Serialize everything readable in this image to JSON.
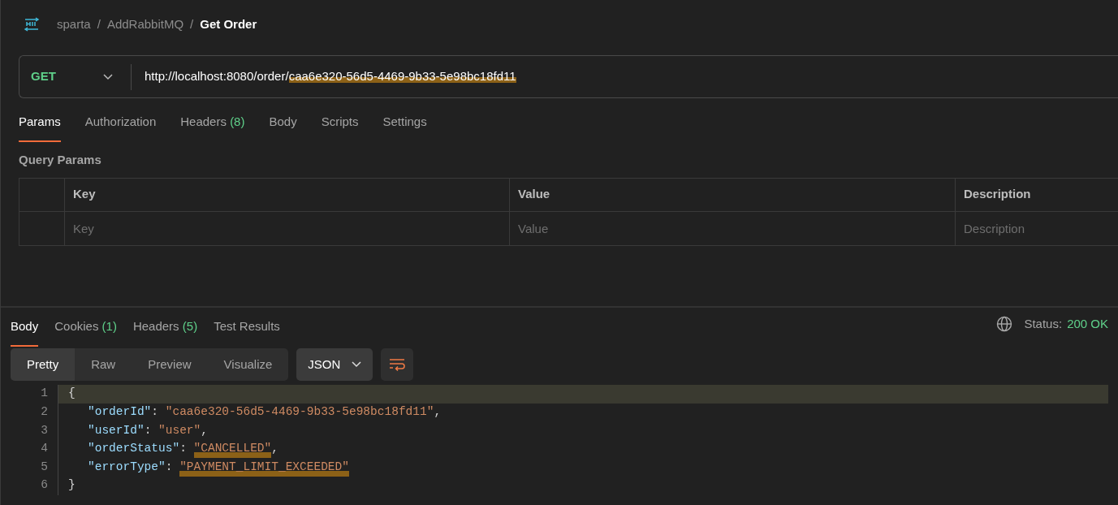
{
  "breadcrumb": [
    {
      "text": "sparta",
      "current": false
    },
    {
      "separator": "/",
      "text": "AddRabbitMQ",
      "current": false
    },
    {
      "separator": "/",
      "text": "Get Order",
      "current": true
    }
  ],
  "request": {
    "method": "GET",
    "url_parts": [
      {
        "text": "http://localhost:8080/order/",
        "highlighted": false
      },
      {
        "text": "caa6e320-56d5-4469-9b33-5e98bc18fd11",
        "highlighted": true
      }
    ]
  },
  "request_tabs": [
    {
      "label": "Params",
      "selected": true
    },
    {
      "label": "Authorization",
      "selected": false
    },
    {
      "label": "Headers",
      "count": "(8)",
      "selected": false
    },
    {
      "label": "Body",
      "selected": false
    },
    {
      "label": "Scripts",
      "selected": false
    },
    {
      "label": "Settings",
      "selected": false
    }
  ],
  "query_params": {
    "title": "Query Params",
    "columns": [
      "Key",
      "Value",
      "Description"
    ],
    "placeholders": [
      "Key",
      "Value",
      "Description"
    ]
  },
  "response_tabs": [
    {
      "label": "Body",
      "selected": true
    },
    {
      "label": "Cookies",
      "count": "(1)",
      "selected": false
    },
    {
      "label": "Headers",
      "count": "(5)",
      "selected": false
    },
    {
      "label": "Test Results",
      "selected": false
    }
  ],
  "status": {
    "label": "Status:",
    "value": "200 OK"
  },
  "view_modes": [
    {
      "label": "Pretty",
      "selected": true
    },
    {
      "label": "Raw",
      "selected": false
    },
    {
      "label": "Preview",
      "selected": false
    },
    {
      "label": "Visualize",
      "selected": false
    }
  ],
  "format": "JSON",
  "code_lines": [
    {
      "number": "1",
      "active": true,
      "indented": false,
      "tokens": [
        {
          "kind": "punct",
          "text": "{",
          "highlighted": false
        }
      ]
    },
    {
      "number": "2",
      "active": false,
      "indented": true,
      "tokens": [
        {
          "kind": "key",
          "text": "\"orderId\"",
          "highlighted": false
        },
        {
          "kind": "punct",
          "text": ": ",
          "highlighted": false
        },
        {
          "kind": "string",
          "text": "\"caa6e320-56d5-4469-9b33-5e98bc18fd11\"",
          "highlighted": false
        },
        {
          "kind": "punct",
          "text": ",",
          "highlighted": false
        }
      ]
    },
    {
      "number": "3",
      "active": false,
      "indented": true,
      "tokens": [
        {
          "kind": "key",
          "text": "\"userId\"",
          "highlighted": false
        },
        {
          "kind": "punct",
          "text": ": ",
          "highlighted": false
        },
        {
          "kind": "string",
          "text": "\"user\"",
          "highlighted": false
        },
        {
          "kind": "punct",
          "text": ",",
          "highlighted": false
        }
      ]
    },
    {
      "number": "4",
      "active": false,
      "indented": true,
      "tokens": [
        {
          "kind": "key",
          "text": "\"orderStatus\"",
          "highlighted": false
        },
        {
          "kind": "punct",
          "text": ": ",
          "highlighted": false
        },
        {
          "kind": "string",
          "text": "\"CANCELLED\"",
          "highlighted": true
        },
        {
          "kind": "punct",
          "text": ",",
          "highlighted": false
        }
      ]
    },
    {
      "number": "5",
      "active": false,
      "indented": true,
      "tokens": [
        {
          "kind": "key",
          "text": "\"errorType\"",
          "highlighted": false
        },
        {
          "kind": "punct",
          "text": ": ",
          "highlighted": false
        },
        {
          "kind": "string",
          "text": "\"PAYMENT_LIMIT_EXCEEDED\"",
          "highlighted": true
        }
      ]
    },
    {
      "number": "6",
      "active": false,
      "indented": false,
      "tokens": [
        {
          "kind": "punct",
          "text": "}",
          "highlighted": false
        }
      ]
    }
  ]
}
